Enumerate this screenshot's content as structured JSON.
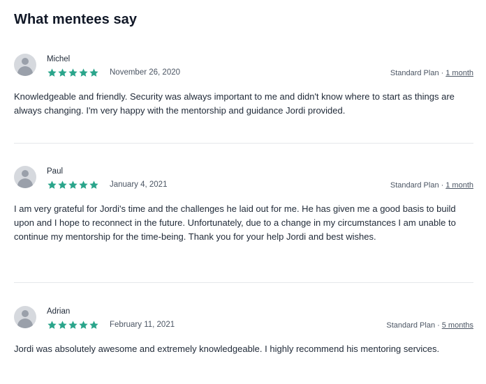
{
  "section": {
    "title": "What mentees say"
  },
  "theme": {
    "star_color": "#2aa58b",
    "divider_color": "#e5e7eb"
  },
  "reviews": [
    {
      "name": "Michel",
      "rating": 5,
      "date": "November 26, 2020",
      "plan": "Standard Plan",
      "separator": "·",
      "duration": "1 month",
      "text": "Knowledgeable and friendly. Security was always important to me and didn't know where to start as things are always changing. I'm very happy with the mentorship and guidance Jordi provided."
    },
    {
      "name": "Paul",
      "rating": 5,
      "date": "January 4, 2021",
      "plan": "Standard Plan",
      "separator": "·",
      "duration": "1 month",
      "text": "I am very grateful for Jordi's time and the challenges he laid out for me. He has given me a good basis to build upon and I hope to reconnect in the future. Unfortunately, due to a change in my circumstances I am unable to continue my mentorship for the time-being. Thank you for your help Jordi and best wishes."
    },
    {
      "name": "Adrian",
      "rating": 5,
      "date": "February 11, 2021",
      "plan": "Standard Plan",
      "separator": "·",
      "duration": "5 months",
      "text": "Jordi was absolutely awesome and extremely knowledgeable. I highly recommend his mentoring services."
    }
  ]
}
